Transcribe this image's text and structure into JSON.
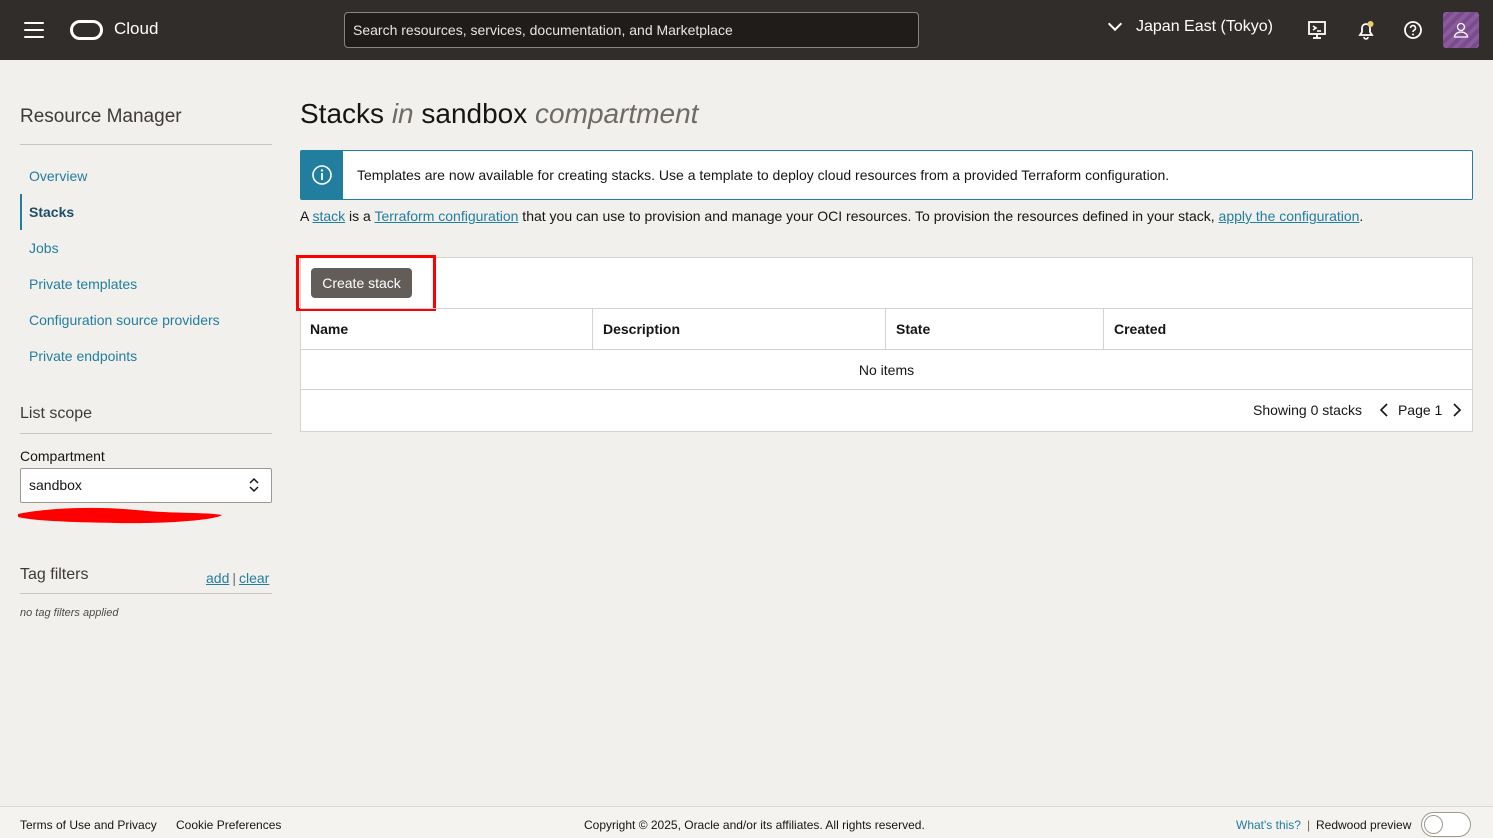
{
  "header": {
    "brand": "Cloud",
    "search_placeholder": "Search resources, services, documentation, and Marketplace",
    "region": "Japan East (Tokyo)"
  },
  "sidebar": {
    "title": "Resource Manager",
    "items": [
      {
        "label": "Overview"
      },
      {
        "label": "Stacks"
      },
      {
        "label": "Jobs"
      },
      {
        "label": "Private templates"
      },
      {
        "label": "Configuration source providers"
      },
      {
        "label": "Private endpoints"
      }
    ],
    "active_item": "Stacks",
    "list_scope": "List scope",
    "compartment_label": "Compartment",
    "compartment_value": "sandbox",
    "tag_filters": "Tag filters",
    "tag_add": "add",
    "tag_sep": "|",
    "tag_clear": "clear",
    "no_tags": "no tag filters applied"
  },
  "main": {
    "title_a": "Stacks",
    "title_in": "in",
    "title_comp": "sandbox",
    "title_comp_suffix": "compartment",
    "banner": "Templates are now available for creating stacks. Use a template to deploy cloud resources from a provided Terraform configuration.",
    "desc": {
      "p1": "A ",
      "link1": "stack",
      "p2": " is a ",
      "link2": "Terraform configuration",
      "p3": " that you can use to provision and manage your OCI resources. To provision the resources defined in your stack, ",
      "link3": "apply the configuration",
      "p4": "."
    },
    "create_button": "Create stack",
    "columns": [
      "Name",
      "Description",
      "State",
      "Created"
    ],
    "empty": "No items",
    "showing": "Showing 0 stacks",
    "page": "Page 1"
  },
  "footer": {
    "terms": "Terms of Use and Privacy",
    "cookies": "Cookie Preferences",
    "copyright": "Copyright © 2025, Oracle and/or its affiliates. All rights reserved.",
    "whats_this": "What's this?",
    "sep": "|",
    "redwood": "Redwood preview"
  },
  "colors": {
    "header_bg": "#312d2a",
    "accent": "#227e9e",
    "highlight": "#ff0000",
    "button_bg": "#625d58"
  }
}
